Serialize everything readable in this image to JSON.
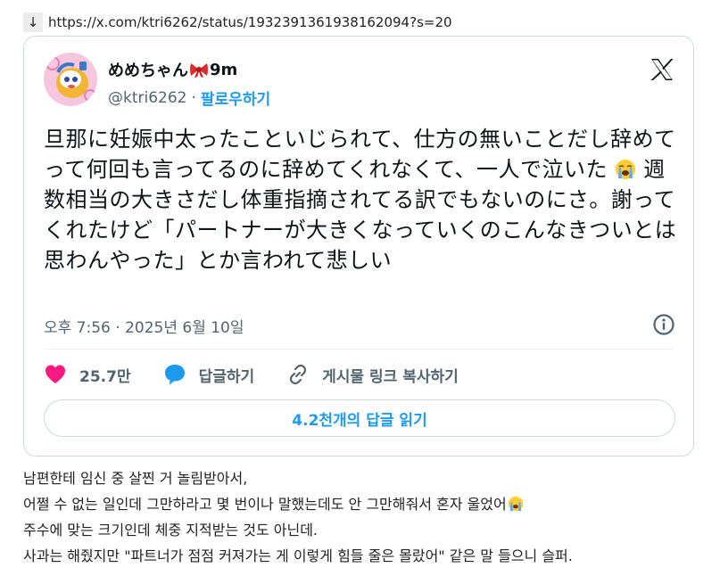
{
  "url": "https://x.com/ktri6262/status/1932391361938162094?s=20",
  "tweet": {
    "author_name": "めめちゃん",
    "author_suffix": "9m",
    "handle": "@ktri6262",
    "separator": "·",
    "follow_label": "팔로우하기",
    "text_part1": "旦那に妊娠中太ったこといじられて、仕方の無いことだし辞めてって何回も言ってるのに辞めてくれなくて、一人で泣いた",
    "text_part2": "週数相当の大きさだし体重指摘されてる訳でもないのにさ。謝ってくれたけど「パートナーが大きくなっていくのこんなきついとは思わんやった」とか言われて悲しい",
    "timestamp": "오후 7:56 · 2025년 6월 10일",
    "likes": "25.7만",
    "reply_label": "답글하기",
    "copy_link_label": "게시물 링크 복사하기",
    "read_replies": "4.2천개의 답글 읽기"
  },
  "translation": {
    "line1": "남편한테 임신 중 살찐 거 놀림받아서,",
    "line2": "어쩔 수 없는 일인데 그만하라고 몇 번이나 말했는데도 안 그만해줘서 혼자 울었어",
    "line3": "주수에 맞는 크기인데 체중 지적받는 것도 아닌데.",
    "line4": "사과는 해줬지만 \"파트너가 점점 커져가는 게 이렇게 힘들 줄은 몰랐어\" 같은 말 들으니 슬퍼."
  },
  "colors": {
    "accent": "#1d9bf0",
    "like": "#f91880",
    "text": "#0f1419",
    "muted": "#536471",
    "border": "#cfd9de"
  },
  "icons": [
    "down-arrow-icon",
    "ribbon-emoji-icon",
    "x-logo-icon",
    "crying-face-emoji-icon",
    "info-icon",
    "heart-icon",
    "reply-bubble-icon",
    "link-icon"
  ]
}
